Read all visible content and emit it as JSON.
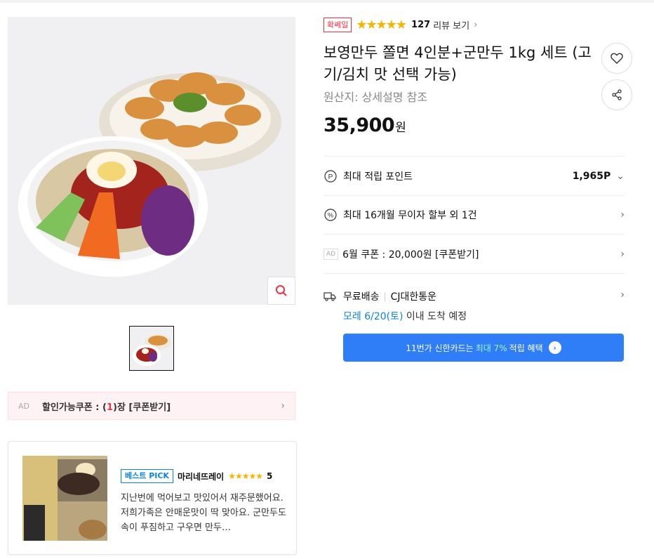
{
  "product": {
    "badge": "확쎄일",
    "rating_stars": "★★★★★",
    "rating_value": 4.5,
    "review_count": "127",
    "review_link": "리뷰 보기",
    "title": "보영만두 쫄면 4인분+군만두 1kg 세트 (고기/김치 맛 선택 가능)",
    "origin": "원산지:  상세설명 참조",
    "price_number": "35,900",
    "price_unit": "원"
  },
  "benefits": {
    "points_label": "최대 적립 포인트",
    "points_value": "1,965P",
    "installment_label": "최대 16개월 무이자 할부 외 1건",
    "ad_tag": "AD",
    "coupon_label": "6월 쿠폰 : 20,000원 [쿠폰받기]"
  },
  "delivery": {
    "free": "무료배송",
    "sep": "|",
    "carrier": "CJ대한통운",
    "date_highlight": "모레 6/20(토)",
    "date_suffix": " 이내 도착 예정"
  },
  "card_banner": {
    "prefix": "11번가 신한카드는",
    "highlight": "최대 7%",
    "suffix": "적립 혜택"
  },
  "left_coupon": {
    "ad": "AD",
    "prefix": "할인가능쿠폰 : (",
    "count": "1",
    "suffix": ")장 [쿠폰받기]"
  },
  "review": {
    "badge": "베스트 PICK",
    "reviewer": "마리네뜨레이",
    "stars": "★★★★★",
    "score": "5",
    "text": "지난번에 먹어보고 맛있어서 재주문했어요. 저희가족은 안매운맛이 딱 맞아요. 군만두도 속이 푸짐하고 구우면 만두…"
  },
  "icons": {
    "zoom": "search-icon",
    "like": "heart-icon",
    "share": "share-icon",
    "points": "point-icon",
    "installment": "percent-icon",
    "truck": "truck-icon",
    "chevron": "chevron-right-icon"
  },
  "colors": {
    "accent_red": "#f43142",
    "accent_blue": "#0b83e6",
    "banner_blue": "#2f7ef7",
    "star": "#f7b500"
  }
}
